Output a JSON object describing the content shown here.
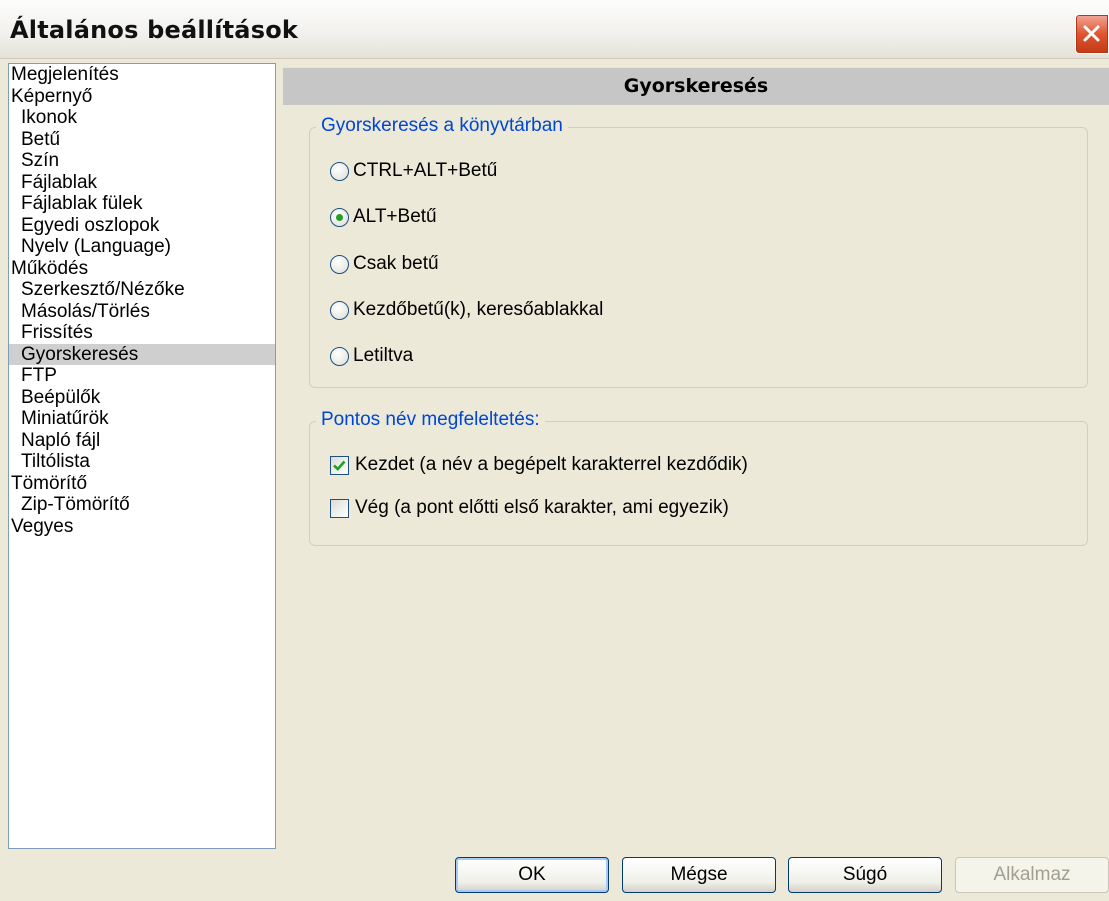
{
  "window": {
    "title": "Általános beállítások",
    "close_icon": "close-icon"
  },
  "sidebar": {
    "items": [
      {
        "label": "Megjelenítés",
        "level": 0
      },
      {
        "label": "Képernyő",
        "level": 0
      },
      {
        "label": "Ikonok",
        "level": 1
      },
      {
        "label": "Betű",
        "level": 1
      },
      {
        "label": "Szín",
        "level": 1
      },
      {
        "label": "Fájlablak",
        "level": 1
      },
      {
        "label": "Fájlablak fülek",
        "level": 1
      },
      {
        "label": "Egyedi oszlopok",
        "level": 1
      },
      {
        "label": "Nyelv (Language)",
        "level": 1
      },
      {
        "label": "Működés",
        "level": 0
      },
      {
        "label": "Szerkesztő/Nézőke",
        "level": 1
      },
      {
        "label": "Másolás/Törlés",
        "level": 1
      },
      {
        "label": "Frissítés",
        "level": 1
      },
      {
        "label": "Gyorskeresés",
        "level": 1,
        "selected": true
      },
      {
        "label": "FTP",
        "level": 1
      },
      {
        "label": "Beépülők",
        "level": 1
      },
      {
        "label": "Miniatűrök",
        "level": 1
      },
      {
        "label": "Napló fájl",
        "level": 1
      },
      {
        "label": "Tiltólista",
        "level": 1
      },
      {
        "label": "Tömörítő",
        "level": 0
      },
      {
        "label": "Zip-Tömörítő",
        "level": 1
      },
      {
        "label": "Vegyes",
        "level": 0
      }
    ]
  },
  "panel": {
    "title": "Gyorskeresés",
    "search_group": {
      "legend": "Gyorskeresés a könyvtárban",
      "options": [
        {
          "label": "CTRL+ALT+Betű",
          "checked": false
        },
        {
          "label": "ALT+Betű",
          "checked": true
        },
        {
          "label": "Csak betű",
          "checked": false
        },
        {
          "label": "Kezdőbetű(k), keresőablakkal",
          "checked": false
        },
        {
          "label": "Letiltva",
          "checked": false
        }
      ]
    },
    "match_group": {
      "legend": "Pontos név megfeleltetés:",
      "options": [
        {
          "label": "Kezdet (a név a begépelt karakterrel kezdődik)",
          "checked": true
        },
        {
          "label": "Vég (a pont előtti első karakter, ami egyezik)",
          "checked": false
        }
      ]
    }
  },
  "buttons": {
    "ok": "OK",
    "cancel": "Mégse",
    "help": "Súgó",
    "apply": "Alkalmaz"
  }
}
